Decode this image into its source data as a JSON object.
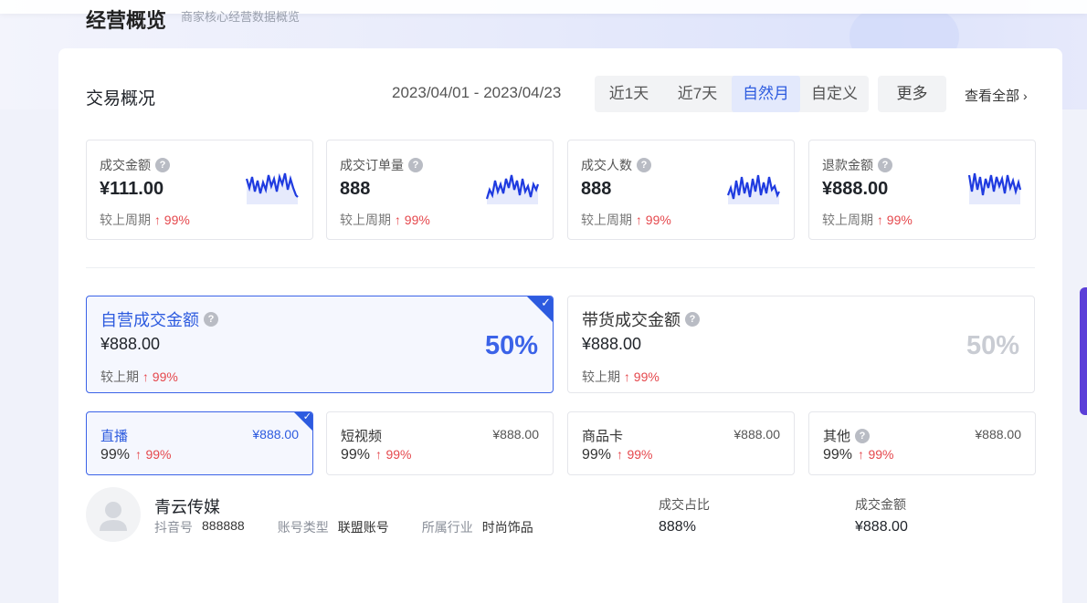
{
  "header": {
    "title": "经营概览",
    "subtitle": "商家核心经营数据概览"
  },
  "overview": {
    "title": "交易概况",
    "date_range": "2023/04/01 - 2023/04/23",
    "tabs": [
      {
        "label": "近1天",
        "active": false
      },
      {
        "label": "近7天",
        "active": false
      },
      {
        "label": "自然月",
        "active": true
      },
      {
        "label": "自定义",
        "active": false
      }
    ],
    "more_label": "更多",
    "view_all_label": "查看全部"
  },
  "kpis": [
    {
      "label": "成交金额",
      "value": "¥111.00",
      "compare_label": "较上周期",
      "change": "99%"
    },
    {
      "label": "成交订单量",
      "value": "888",
      "compare_label": "较上周期",
      "change": "99%"
    },
    {
      "label": "成交人数",
      "value": "888",
      "compare_label": "较上周期",
      "change": "99%"
    },
    {
      "label": "退款金额",
      "value": "¥888.00",
      "compare_label": "较上周期",
      "change": "99%"
    }
  ],
  "split": [
    {
      "label": "自营成交金额",
      "value": "¥888.00",
      "percent": "50%",
      "compare_label": "较上期",
      "change": "99%",
      "selected": true
    },
    {
      "label": "带货成交金额",
      "value": "¥888.00",
      "percent": "50%",
      "compare_label": "较上期",
      "change": "99%",
      "selected": false
    }
  ],
  "channels": [
    {
      "label": "直播",
      "amount": "¥888.00",
      "ratio": "99%",
      "change": "99%",
      "selected": true,
      "help": false
    },
    {
      "label": "短视频",
      "amount": "¥888.00",
      "ratio": "99%",
      "change": "99%",
      "selected": false,
      "help": false
    },
    {
      "label": "商品卡",
      "amount": "¥888.00",
      "ratio": "99%",
      "change": "99%",
      "selected": false,
      "help": false
    },
    {
      "label": "其他",
      "amount": "¥888.00",
      "ratio": "99%",
      "change": "99%",
      "selected": false,
      "help": true
    }
  ],
  "account": {
    "name": "青云传媒",
    "douyin_label": "抖音号",
    "douyin_value": "888888",
    "type_label": "账号类型",
    "type_value": "联盟账号",
    "industry_label": "所属行业",
    "industry_value": "时尚饰品",
    "share_label": "成交占比",
    "share_value": "888%",
    "amount_label": "成交金额",
    "amount_value": "¥888.00"
  },
  "colors": {
    "accent": "#2d5bdf",
    "up": "#e5484d",
    "sparkline": "#1f3be0"
  },
  "icons": {
    "help": "question-circle-icon",
    "arrow_up": "arrow-up-icon",
    "check": "check-icon",
    "chevron": "chevron-right-icon"
  }
}
